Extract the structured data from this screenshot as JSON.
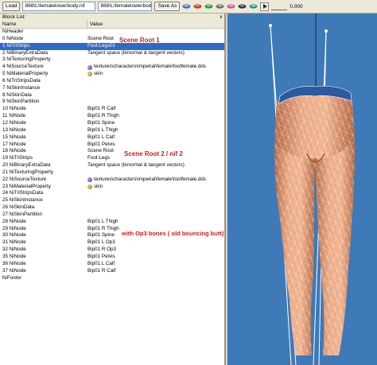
{
  "toolbar": {
    "load_label": "Load",
    "load_path": "888\\L\\femalelowerbody.nif",
    "save_path": "888\\L\\femalelowerbody.nif",
    "save_as_label": "Save As",
    "play_icon": "play-icon",
    "time_value": "0.000"
  },
  "block_list": {
    "title": "Block List",
    "close_glyph": "x",
    "col_name": "Name",
    "col_value": "Value",
    "rows": [
      {
        "name": "NiHeader",
        "value": ""
      },
      {
        "name": "0   NiNode",
        "value": "Scene Root"
      },
      {
        "name": "1   NiTriStrips",
        "value": "Foot:Legs01"
      },
      {
        "name": "2   NiBinaryExtraData",
        "value": "Tangent space (binormal & tangent vectors)"
      },
      {
        "name": "3   NiTexturingProperty",
        "value": ""
      },
      {
        "name": "4   NiSourceTexture",
        "value": "textures\\characters\\imperial\\female\\footfemale.dds"
      },
      {
        "name": "5   NiMaterialProperty",
        "value": "skin"
      },
      {
        "name": "6   NiTriStripsData",
        "value": ""
      },
      {
        "name": "7   NiSkinInstance",
        "value": ""
      },
      {
        "name": "8   NiSkinData",
        "value": ""
      },
      {
        "name": "9   NiSkinPartition",
        "value": ""
      },
      {
        "name": "10  NiNode",
        "value": "Bip01 R Calf"
      },
      {
        "name": "11  NiNode",
        "value": "Bip01 R Thigh"
      },
      {
        "name": "12  NiNode",
        "value": "Bip01 Spine"
      },
      {
        "name": "13  NiNode",
        "value": "Bip01 L Thigh"
      },
      {
        "name": "15  NiNode",
        "value": "Bip01 L Calf"
      },
      {
        "name": "17  NiNode",
        "value": "Bip01 Pelvis"
      },
      {
        "name": "18  NiNode",
        "value": "Scene Root"
      },
      {
        "name": "19  NiTriStrips",
        "value": "Foot:Legs"
      },
      {
        "name": "20  NiBinaryExtraData",
        "value": "Tangent space (binormal & tangent vectors)"
      },
      {
        "name": "21  NiTexturingProperty",
        "value": ""
      },
      {
        "name": "22  NiSourceTexture",
        "value": "textures\\characters\\imperial\\female\\footfemale.dds"
      },
      {
        "name": "23  NiMaterialProperty",
        "value": "skin"
      },
      {
        "name": "24  NiTriStripsData",
        "value": ""
      },
      {
        "name": "25  NiSkinInstance",
        "value": ""
      },
      {
        "name": "26  NiSkinData",
        "value": ""
      },
      {
        "name": "27  NiSkinPartition",
        "value": ""
      },
      {
        "name": "28  NiNode",
        "value": "Bip01 L Thigh"
      },
      {
        "name": "29  NiNode",
        "value": "Bip01 R Thigh"
      },
      {
        "name": "30  NiNode",
        "value": "Bip01 Spine"
      },
      {
        "name": "31  NiNode",
        "value": "Bip01 L Op3"
      },
      {
        "name": "32  NiNode",
        "value": "Bip01 R Op3"
      },
      {
        "name": "35  NiNode",
        "value": "Bip01 Pelvis"
      },
      {
        "name": "36  NiNode",
        "value": "Bip01 L Calf"
      },
      {
        "name": "37  NiNode",
        "value": "Bip01 R Calf"
      },
      {
        "name": "NiFooter",
        "value": ""
      }
    ],
    "selected_row": 2
  },
  "annotations": {
    "scene_root_1": "Scene Root 1",
    "scene_root_2": "Scene Root 2   / nif 2",
    "op3_bones": "with Op3 bones ( old bouncing butt)"
  },
  "colors": {
    "selection": "#316ac5",
    "annotation": "#d21a1a",
    "viewport_bg": "#3e79b8",
    "skin": "#e8a77f"
  }
}
